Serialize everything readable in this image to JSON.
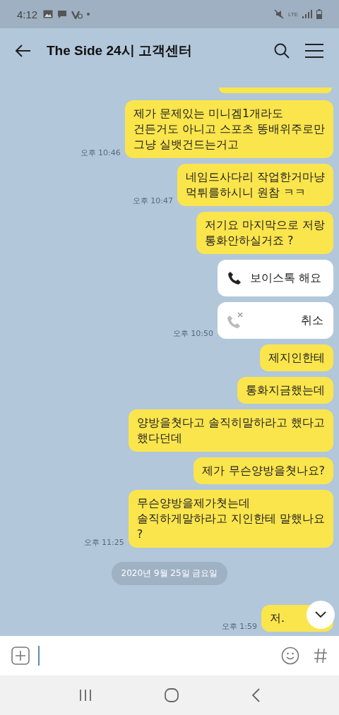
{
  "status_bar": {
    "time": "4:12",
    "network": "LTE"
  },
  "header": {
    "title": "The Side 24시 고객센터"
  },
  "messages": [
    {
      "kind": "text",
      "text": "제가 문제있는 미니겜1개라도\n건든거도 아니고 스포츠 똥배위주로만\n그냥 실뱃건드는거고",
      "time": "오후 10:46"
    },
    {
      "kind": "text",
      "text": "네임드사다리 작업한거마냥\n먹튀를하시니 원참 ㅋㅋ",
      "time": "오후 10:47"
    },
    {
      "kind": "text",
      "text": "저기요 마지막으로 저랑\n통화안하실거죠 ?"
    },
    {
      "kind": "call",
      "text": "보이스톡 해요",
      "cancelled": false
    },
    {
      "kind": "call",
      "text": "취소",
      "cancelled": true,
      "time": "오후 10:50"
    },
    {
      "kind": "text",
      "text": "제지인한테"
    },
    {
      "kind": "text",
      "text": "통화지금했는데"
    },
    {
      "kind": "text",
      "text": "양방을쳣다고 솔직히말하라고 했다고\n했다던데"
    },
    {
      "kind": "text",
      "text": "제가 무슨양방을쳣나요?"
    },
    {
      "kind": "text",
      "text": "무슨양방을제가쳣는데\n솔직하게말하라고 지인한테 말했나요\n?",
      "time": "오후 11:25"
    },
    {
      "kind": "date",
      "text": "2020년 9월 25일 금요일"
    },
    {
      "kind": "text",
      "text": "저.",
      "time": "오후 1:59"
    }
  ]
}
